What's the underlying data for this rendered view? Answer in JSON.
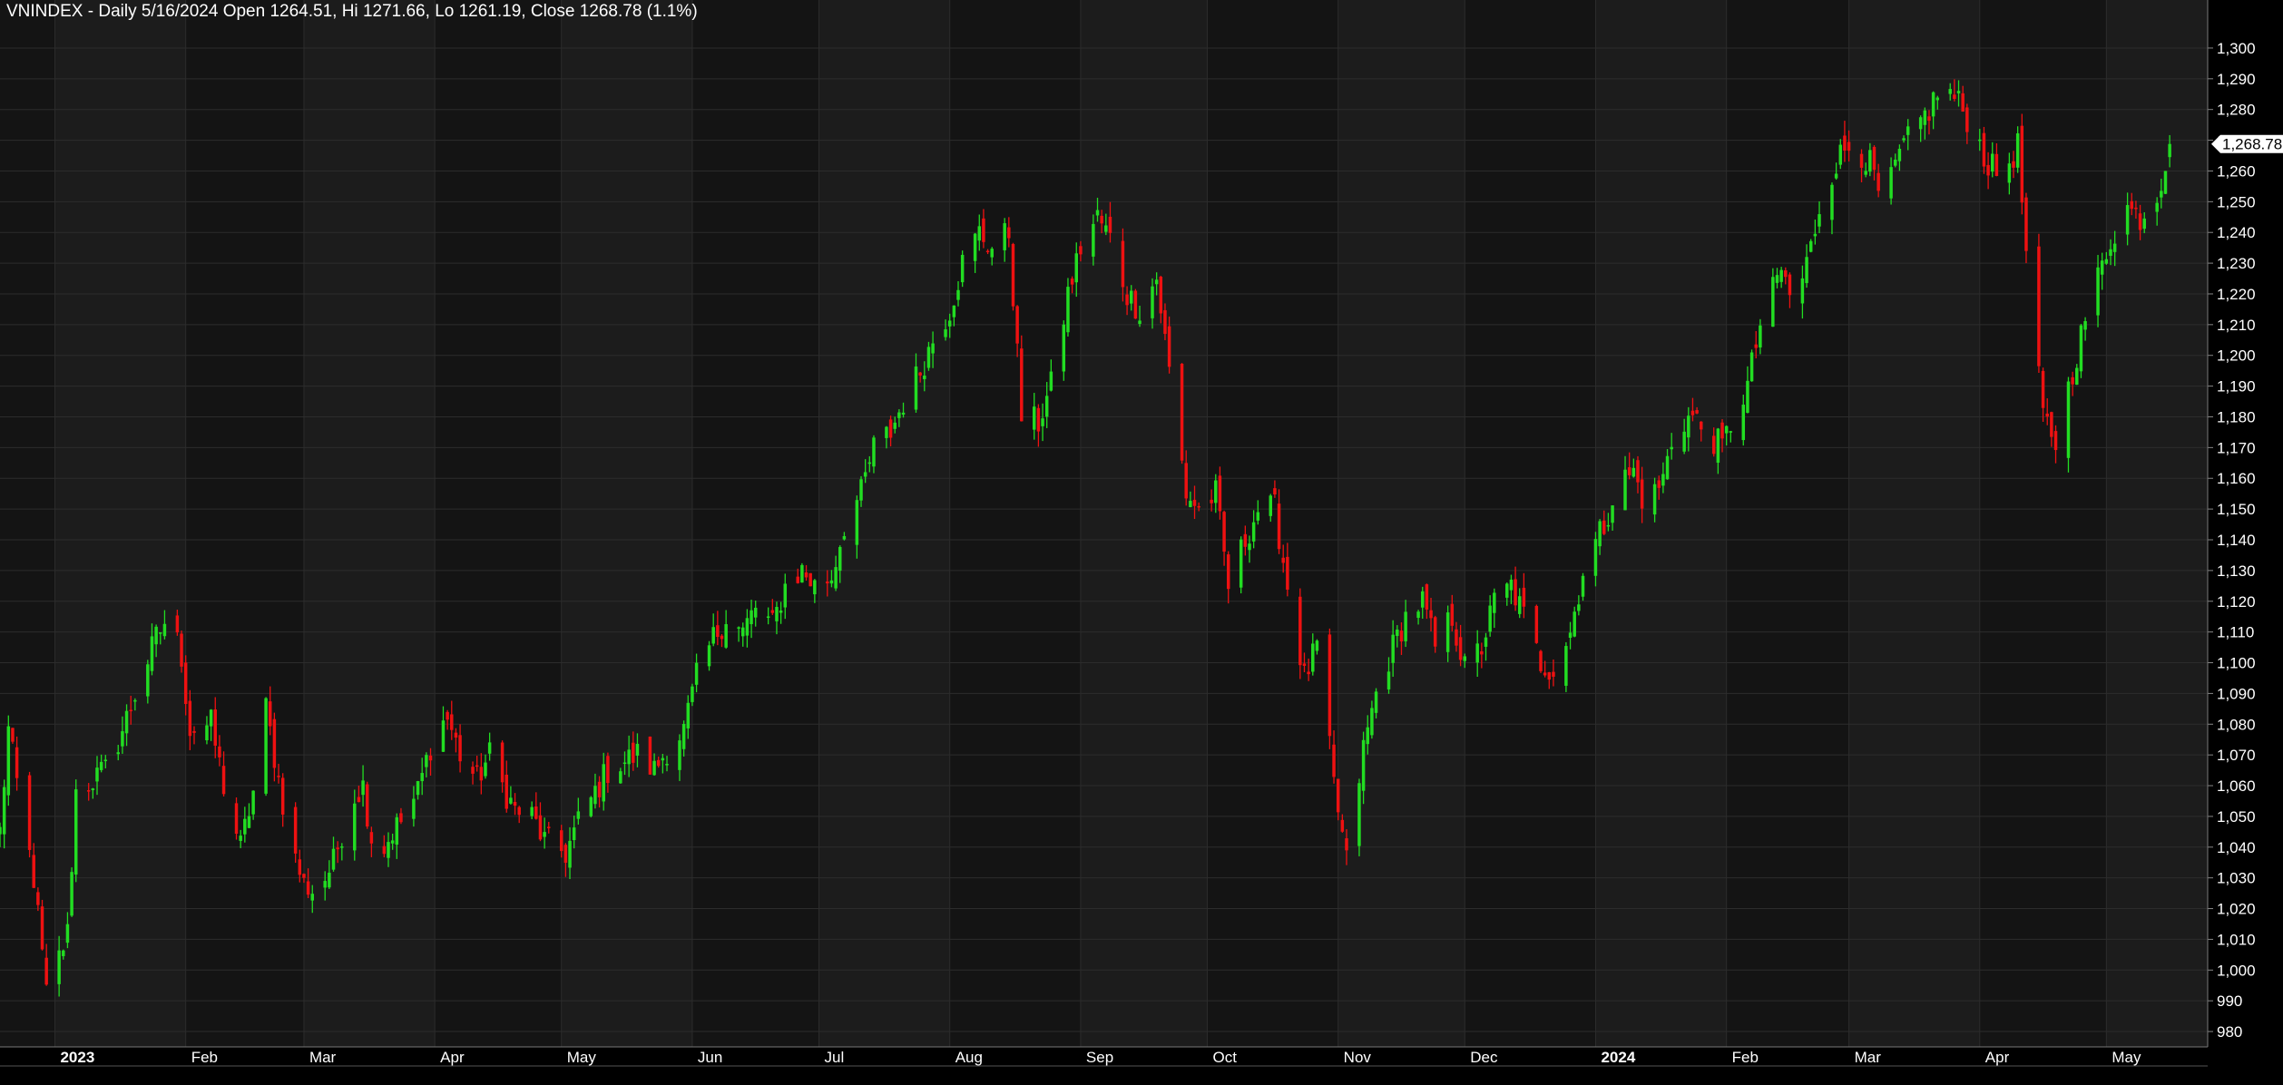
{
  "header": {
    "symbol": "VNINDEX",
    "interval": "Daily",
    "date": "5/16/2024",
    "open_label": "Open",
    "open": "1264.51",
    "high_label": "Hi",
    "high": "1271.66",
    "low_label": "Lo",
    "low": "1261.19",
    "close_label": "Close",
    "close": "1268.78",
    "change": "(1.1%)"
  },
  "colors": {
    "background": "#000000",
    "band_dark": "#141414",
    "band_light": "#1c1c1c",
    "grid": "#2c2c2c",
    "up": "#22dd22",
    "down": "#ee1111",
    "text": "#ffffff",
    "price_tag_bg": "#ffffff",
    "price_tag_text": "#000000"
  },
  "chart_data": {
    "type": "candlestick",
    "title": "VNINDEX - Daily",
    "ylim": [
      975,
      1305
    ],
    "y_ticks": [
      980,
      990,
      1000,
      1010,
      1020,
      1030,
      1040,
      1050,
      1060,
      1070,
      1080,
      1090,
      1100,
      1110,
      1120,
      1130,
      1140,
      1150,
      1160,
      1170,
      1180,
      1190,
      1200,
      1210,
      1220,
      1230,
      1240,
      1250,
      1260,
      1270,
      1280,
      1290,
      1300
    ],
    "last_price_label": "1,268.78",
    "last_price": 1268.78,
    "x_axis_start": "2022-12-19",
    "x_axis_end": "2024-05-25",
    "month_labels": [
      {
        "label": "2023",
        "date": "2023-01-01",
        "bold": true
      },
      {
        "label": "Feb",
        "date": "2023-02-01"
      },
      {
        "label": "Mar",
        "date": "2023-03-01"
      },
      {
        "label": "Apr",
        "date": "2023-04-01"
      },
      {
        "label": "May",
        "date": "2023-05-01"
      },
      {
        "label": "Jun",
        "date": "2023-06-01"
      },
      {
        "label": "Jul",
        "date": "2023-07-01"
      },
      {
        "label": "Aug",
        "date": "2023-08-01"
      },
      {
        "label": "Sep",
        "date": "2023-09-01"
      },
      {
        "label": "Oct",
        "date": "2023-10-01"
      },
      {
        "label": "Nov",
        "date": "2023-11-01"
      },
      {
        "label": "Dec",
        "date": "2023-12-01"
      },
      {
        "label": "2024",
        "date": "2024-01-01",
        "bold": true
      },
      {
        "label": "Feb",
        "date": "2024-02-01"
      },
      {
        "label": "Mar",
        "date": "2024-03-01"
      },
      {
        "label": "Apr",
        "date": "2024-04-01"
      },
      {
        "label": "May",
        "date": "2024-05-01"
      }
    ],
    "closes": [
      {
        "date": "2022-12-19",
        "close": 1045
      },
      {
        "date": "2022-12-21",
        "close": 1078
      },
      {
        "date": "2022-12-24",
        "close": 1052
      },
      {
        "date": "2022-12-27",
        "close": 1030
      },
      {
        "date": "2022-12-30",
        "close": 992
      },
      {
        "date": "2023-01-04",
        "close": 1012
      },
      {
        "date": "2023-01-06",
        "close": 1058
      },
      {
        "date": "2023-01-10",
        "close": 1062
      },
      {
        "date": "2023-01-13",
        "close": 1065
      },
      {
        "date": "2023-01-17",
        "close": 1078
      },
      {
        "date": "2023-01-20",
        "close": 1090
      },
      {
        "date": "2023-01-25",
        "close": 1108
      },
      {
        "date": "2023-01-28",
        "close": 1116
      },
      {
        "date": "2023-01-31",
        "close": 1102
      },
      {
        "date": "2023-02-02",
        "close": 1078
      },
      {
        "date": "2023-02-07",
        "close": 1080
      },
      {
        "date": "2023-02-10",
        "close": 1060
      },
      {
        "date": "2023-02-14",
        "close": 1040
      },
      {
        "date": "2023-02-17",
        "close": 1058
      },
      {
        "date": "2023-02-20",
        "close": 1085
      },
      {
        "date": "2023-02-23",
        "close": 1062
      },
      {
        "date": "2023-02-26",
        "close": 1040
      },
      {
        "date": "2023-03-01",
        "close": 1028
      },
      {
        "date": "2023-03-04",
        "close": 1025
      },
      {
        "date": "2023-03-08",
        "close": 1035
      },
      {
        "date": "2023-03-12",
        "close": 1055
      },
      {
        "date": "2023-03-15",
        "close": 1060
      },
      {
        "date": "2023-03-18",
        "close": 1035
      },
      {
        "date": "2023-03-22",
        "close": 1045
      },
      {
        "date": "2023-03-25",
        "close": 1050
      },
      {
        "date": "2023-03-28",
        "close": 1058
      },
      {
        "date": "2023-04-01",
        "close": 1078
      },
      {
        "date": "2023-04-04",
        "close": 1082
      },
      {
        "date": "2023-04-07",
        "close": 1070
      },
      {
        "date": "2023-04-11",
        "close": 1062
      },
      {
        "date": "2023-04-14",
        "close": 1070
      },
      {
        "date": "2023-04-17",
        "close": 1060
      },
      {
        "date": "2023-04-20",
        "close": 1052
      },
      {
        "date": "2023-04-24",
        "close": 1050
      },
      {
        "date": "2023-04-27",
        "close": 1042
      },
      {
        "date": "2023-05-02",
        "close": 1038
      },
      {
        "date": "2023-05-05",
        "close": 1048
      },
      {
        "date": "2023-05-09",
        "close": 1058
      },
      {
        "date": "2023-05-12",
        "close": 1065
      },
      {
        "date": "2023-05-16",
        "close": 1068
      },
      {
        "date": "2023-05-19",
        "close": 1070
      },
      {
        "date": "2023-05-23",
        "close": 1065
      },
      {
        "date": "2023-05-26",
        "close": 1072
      },
      {
        "date": "2023-05-30",
        "close": 1078
      },
      {
        "date": "2023-06-02",
        "close": 1095
      },
      {
        "date": "2023-06-06",
        "close": 1108
      },
      {
        "date": "2023-06-09",
        "close": 1115
      },
      {
        "date": "2023-06-13",
        "close": 1110
      },
      {
        "date": "2023-06-16",
        "close": 1118
      },
      {
        "date": "2023-06-20",
        "close": 1112
      },
      {
        "date": "2023-06-23",
        "close": 1125
      },
      {
        "date": "2023-06-27",
        "close": 1130
      },
      {
        "date": "2023-06-30",
        "close": 1125
      },
      {
        "date": "2023-07-04",
        "close": 1128
      },
      {
        "date": "2023-07-07",
        "close": 1145
      },
      {
        "date": "2023-07-11",
        "close": 1155
      },
      {
        "date": "2023-07-14",
        "close": 1170
      },
      {
        "date": "2023-07-18",
        "close": 1175
      },
      {
        "date": "2023-07-21",
        "close": 1185
      },
      {
        "date": "2023-07-25",
        "close": 1195
      },
      {
        "date": "2023-07-28",
        "close": 1205
      },
      {
        "date": "2023-08-01",
        "close": 1215
      },
      {
        "date": "2023-08-04",
        "close": 1230
      },
      {
        "date": "2023-08-08",
        "close": 1240
      },
      {
        "date": "2023-08-11",
        "close": 1235
      },
      {
        "date": "2023-08-15",
        "close": 1240
      },
      {
        "date": "2023-08-18",
        "close": 1180
      },
      {
        "date": "2023-08-22",
        "close": 1178
      },
      {
        "date": "2023-08-25",
        "close": 1190
      },
      {
        "date": "2023-08-29",
        "close": 1220
      },
      {
        "date": "2023-09-01",
        "close": 1235
      },
      {
        "date": "2023-09-05",
        "close": 1245
      },
      {
        "date": "2023-09-08",
        "close": 1238
      },
      {
        "date": "2023-09-12",
        "close": 1220
      },
      {
        "date": "2023-09-15",
        "close": 1215
      },
      {
        "date": "2023-09-19",
        "close": 1225
      },
      {
        "date": "2023-09-22",
        "close": 1195
      },
      {
        "date": "2023-09-26",
        "close": 1155
      },
      {
        "date": "2023-09-29",
        "close": 1150
      },
      {
        "date": "2023-10-03",
        "close": 1155
      },
      {
        "date": "2023-10-06",
        "close": 1125
      },
      {
        "date": "2023-10-10",
        "close": 1140
      },
      {
        "date": "2023-10-13",
        "close": 1150
      },
      {
        "date": "2023-10-17",
        "close": 1150
      },
      {
        "date": "2023-10-20",
        "close": 1125
      },
      {
        "date": "2023-10-24",
        "close": 1095
      },
      {
        "date": "2023-10-27",
        "close": 1105
      },
      {
        "date": "2023-10-31",
        "close": 1060
      },
      {
        "date": "2023-11-03",
        "close": 1035
      },
      {
        "date": "2023-11-07",
        "close": 1072
      },
      {
        "date": "2023-11-10",
        "close": 1090
      },
      {
        "date": "2023-11-14",
        "close": 1105
      },
      {
        "date": "2023-11-17",
        "close": 1115
      },
      {
        "date": "2023-11-21",
        "close": 1120
      },
      {
        "date": "2023-11-24",
        "close": 1105
      },
      {
        "date": "2023-11-28",
        "close": 1115
      },
      {
        "date": "2023-12-01",
        "close": 1098
      },
      {
        "date": "2023-12-05",
        "close": 1105
      },
      {
        "date": "2023-12-08",
        "close": 1120
      },
      {
        "date": "2023-12-12",
        "close": 1125
      },
      {
        "date": "2023-12-15",
        "close": 1115
      },
      {
        "date": "2023-12-19",
        "close": 1100
      },
      {
        "date": "2023-12-22",
        "close": 1098
      },
      {
        "date": "2023-12-26",
        "close": 1110
      },
      {
        "date": "2023-12-29",
        "close": 1130
      },
      {
        "date": "2024-01-03",
        "close": 1145
      },
      {
        "date": "2024-01-06",
        "close": 1158
      },
      {
        "date": "2024-01-10",
        "close": 1162
      },
      {
        "date": "2024-01-13",
        "close": 1150
      },
      {
        "date": "2024-01-17",
        "close": 1160
      },
      {
        "date": "2024-01-20",
        "close": 1178
      },
      {
        "date": "2024-01-24",
        "close": 1180
      },
      {
        "date": "2024-01-27",
        "close": 1175
      },
      {
        "date": "2024-01-31",
        "close": 1170
      },
      {
        "date": "2024-02-02",
        "close": 1178
      },
      {
        "date": "2024-02-06",
        "close": 1190
      },
      {
        "date": "2024-02-09",
        "close": 1210
      },
      {
        "date": "2024-02-14",
        "close": 1228
      },
      {
        "date": "2024-02-17",
        "close": 1215
      },
      {
        "date": "2024-02-21",
        "close": 1235
      },
      {
        "date": "2024-02-24",
        "close": 1255
      },
      {
        "date": "2024-02-28",
        "close": 1265
      },
      {
        "date": "2024-03-02",
        "close": 1270
      },
      {
        "date": "2024-03-06",
        "close": 1262
      },
      {
        "date": "2024-03-09",
        "close": 1248
      },
      {
        "date": "2024-03-13",
        "close": 1265
      },
      {
        "date": "2024-03-16",
        "close": 1272
      },
      {
        "date": "2024-03-20",
        "close": 1280
      },
      {
        "date": "2024-03-23",
        "close": 1288
      },
      {
        "date": "2024-03-27",
        "close": 1282
      },
      {
        "date": "2024-03-30",
        "close": 1275
      },
      {
        "date": "2024-04-03",
        "close": 1262
      },
      {
        "date": "2024-04-06",
        "close": 1258
      },
      {
        "date": "2024-04-10",
        "close": 1268
      },
      {
        "date": "2024-04-13",
        "close": 1215
      },
      {
        "date": "2024-04-16",
        "close": 1180
      },
      {
        "date": "2024-04-19",
        "close": 1172
      },
      {
        "date": "2024-04-23",
        "close": 1195
      },
      {
        "date": "2024-04-26",
        "close": 1212
      },
      {
        "date": "2024-04-29",
        "close": 1225
      },
      {
        "date": "2024-05-02",
        "close": 1238
      },
      {
        "date": "2024-05-06",
        "close": 1248
      },
      {
        "date": "2024-05-09",
        "close": 1245
      },
      {
        "date": "2024-05-13",
        "close": 1252
      },
      {
        "date": "2024-05-16",
        "close": 1268.78
      }
    ]
  }
}
